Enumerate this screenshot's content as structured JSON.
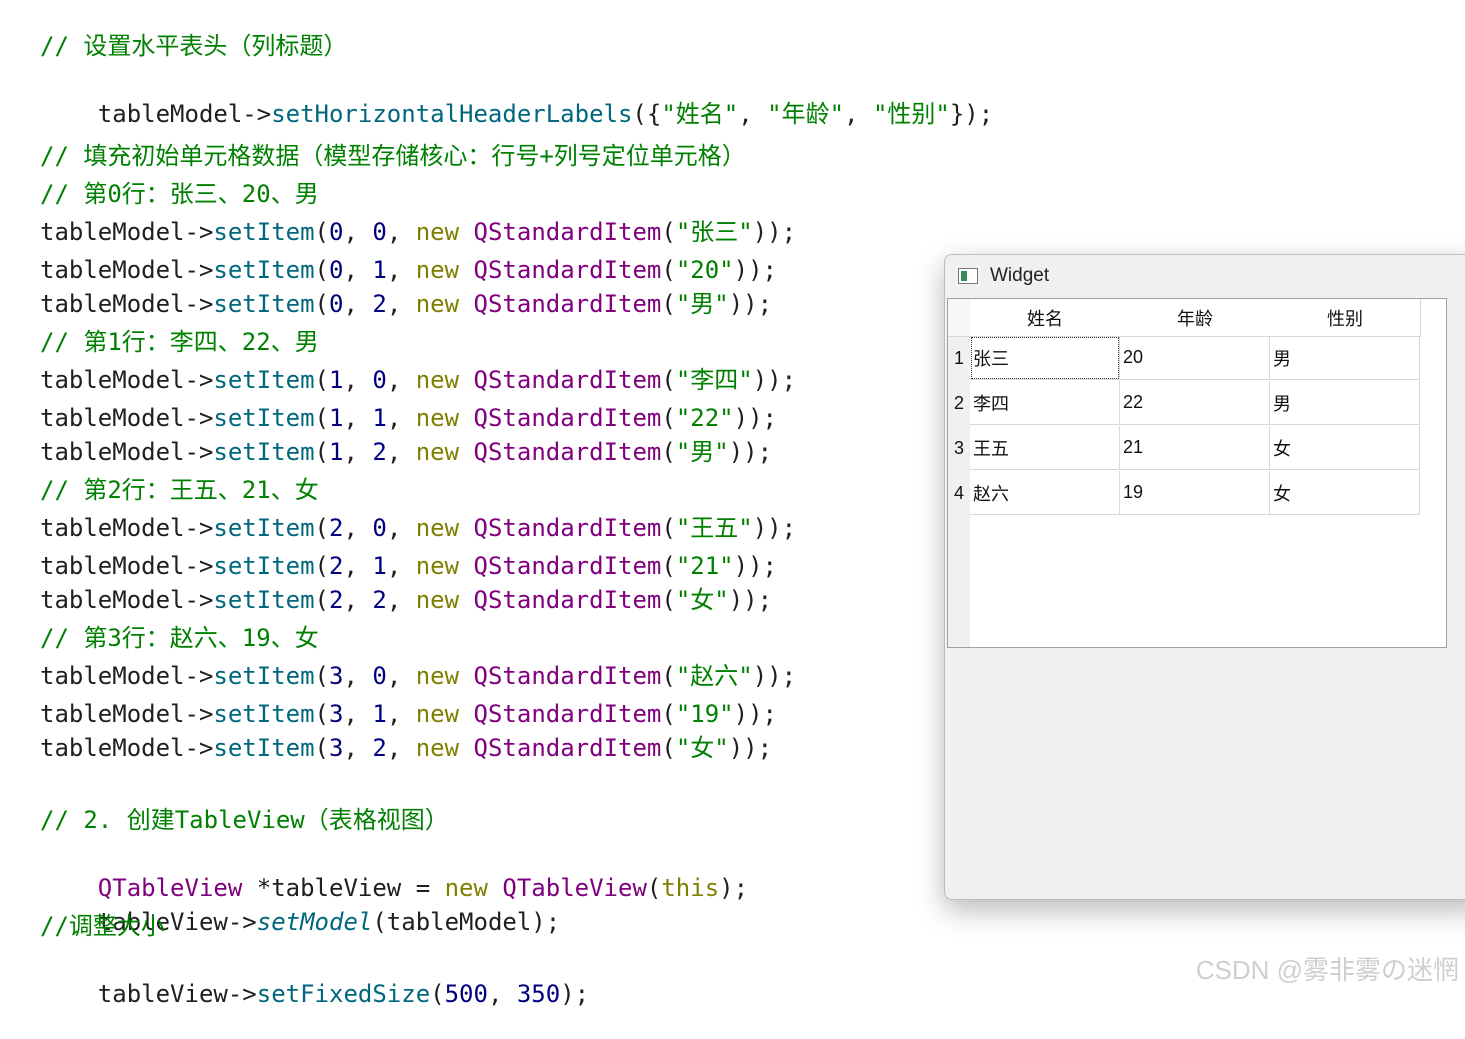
{
  "code": {
    "l1": "// 设置水平表头（列标题）",
    "l2": {
      "obj": "tableModel->",
      "fn": "setHorizontalHeaderLabels",
      "open": "({",
      "s1": "\"姓名\"",
      "c1": ", ",
      "s2": "\"年龄\"",
      "c2": ", ",
      "s3": "\"性别\"",
      "close": "});"
    },
    "l3": "// 填充初始单元格数据（模型存储核心：行号+列号定位单元格）",
    "comment_row0": "// 第0行：张三、20、男",
    "comment_row1": "// 第1行：李四、22、男",
    "comment_row2": "// 第2行：王五、21、女",
    "comment_row3": "// 第3行：赵六、19、女",
    "set_items": [
      {
        "r": "0",
        "c": "0",
        "v": "\"张三\""
      },
      {
        "r": "0",
        "c": "1",
        "v": "\"20\""
      },
      {
        "r": "0",
        "c": "2",
        "v": "\"男\""
      },
      {
        "r": "1",
        "c": "0",
        "v": "\"李四\""
      },
      {
        "r": "1",
        "c": "1",
        "v": "\"22\""
      },
      {
        "r": "1",
        "c": "2",
        "v": "\"男\""
      },
      {
        "r": "2",
        "c": "0",
        "v": "\"王五\""
      },
      {
        "r": "2",
        "c": "1",
        "v": "\"21\""
      },
      {
        "r": "2",
        "c": "2",
        "v": "\"女\""
      },
      {
        "r": "3",
        "c": "0",
        "v": "\"赵六\""
      },
      {
        "r": "3",
        "c": "1",
        "v": "\"19\""
      },
      {
        "r": "3",
        "c": "2",
        "v": "\"女\""
      }
    ],
    "tokens": {
      "obj": "tableModel->",
      "fn": "setItem",
      "lp": "(",
      "sep": ", ",
      "kw_new": "new",
      "sp": " ",
      "cls": "QStandardItem",
      "end": "));"
    },
    "l_create_comment": "// 2. 创建TableView（表格视图）",
    "l_create": {
      "cls": "QTableView",
      "var": " *tableView = ",
      "kw": "new",
      "sp": " ",
      "cls2": "QTableView",
      "lp": "(",
      "this": "this",
      "end": ");"
    },
    "l_setmodel": {
      "obj": "tableView->",
      "fn": "setModel",
      "args": "(tableModel);"
    },
    "l_resize_comment": "//调整大小",
    "l_fixed": {
      "obj": "tableView->",
      "fn": "setFixedSize",
      "lp": "(",
      "n1": "500",
      "sep": ", ",
      "n2": "350",
      "end": ");"
    }
  },
  "widget": {
    "title": "Widget",
    "headers": [
      "姓名",
      "年龄",
      "性别"
    ],
    "row_numbers": [
      "1",
      "2",
      "3",
      "4"
    ],
    "rows": [
      [
        "张三",
        "20",
        "男"
      ],
      [
        "李四",
        "22",
        "男"
      ],
      [
        "王五",
        "21",
        "女"
      ],
      [
        "赵六",
        "19",
        "女"
      ]
    ]
  },
  "watermark": "CSDN @雾非雾の迷惘",
  "colors": {
    "comment": "#008000",
    "function": "#00677c",
    "number": "#000080",
    "keyword": "#808000",
    "class": "#800080",
    "string": "#008000"
  }
}
